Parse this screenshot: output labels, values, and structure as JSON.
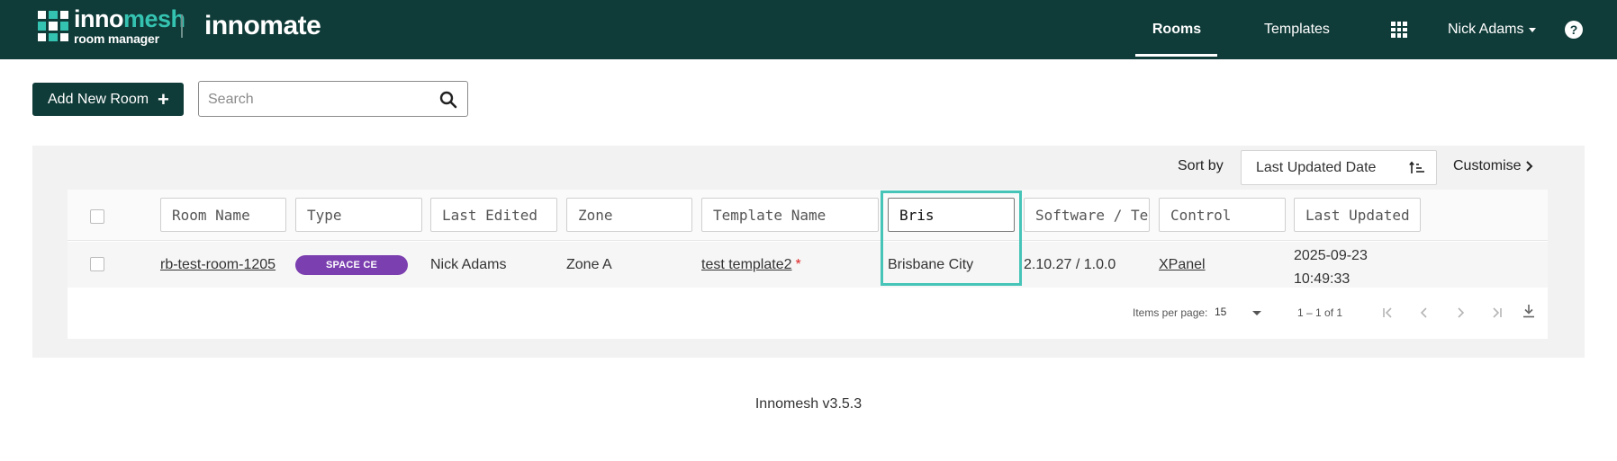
{
  "header": {
    "logo": {
      "brand_prefix": "inno",
      "brand_suffix": "mesh",
      "tagline": "room manager"
    },
    "product_name": "innomate",
    "nav": {
      "rooms": "Rooms",
      "templates": "Templates",
      "user": "Nick Adams"
    },
    "help_glyph": "?"
  },
  "toolbar": {
    "add_button": "Add New Room",
    "add_plus": "+",
    "search_placeholder": "Search",
    "search_value": ""
  },
  "sort": {
    "label": "Sort by",
    "selected": "Last Updated Date",
    "customise": "Customise"
  },
  "table": {
    "filters": {
      "room_name": "Room Name",
      "type": "Type",
      "last_edited": "Last Edited",
      "zone": "Zone",
      "template_name": "Template Name",
      "location_value": "Bris",
      "software": "Software / Template",
      "control": "Control",
      "last_updated": "Last Updated"
    },
    "rows": [
      {
        "room_name": "rb-test-room-1205",
        "type": "SPACE CE",
        "last_edited": "Nick Adams",
        "zone": "Zone A",
        "template_name": "test template2",
        "template_flag": "*",
        "location": "Brisbane City",
        "software": "2.10.27 / 1.0.0",
        "control": "XPanel",
        "updated_date": "2025-09-23",
        "updated_time": "10:49:33"
      }
    ]
  },
  "paginator": {
    "items_label": "Items per page:",
    "page_size": "15",
    "range": "1 – 1 of 1"
  },
  "footer": {
    "version": "Innomesh v3.5.3"
  },
  "colors": {
    "header_bg": "#0f3b38",
    "accent": "#35c3b1",
    "badge": "#7b3fb0",
    "highlight": "#46c4b8"
  }
}
